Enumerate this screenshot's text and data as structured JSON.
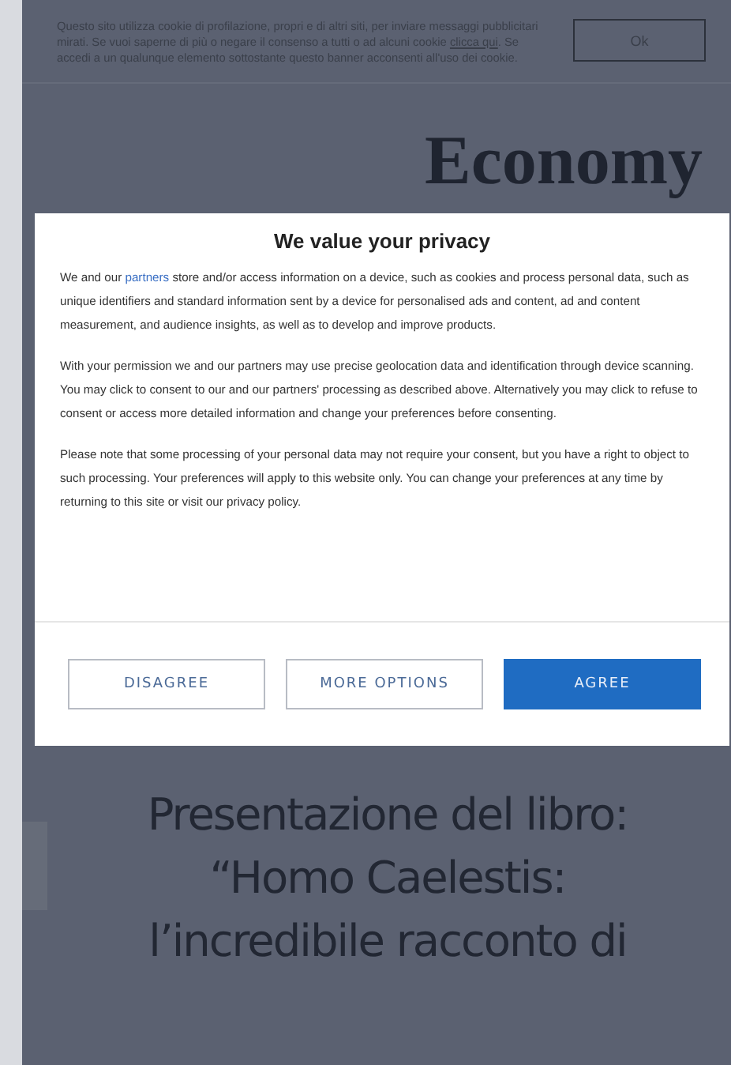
{
  "cookie_banner": {
    "text": "Questo sito utilizza cookie di profilazione, propri e di altri siti, per inviare messaggi pubblicitari mirati. Se vuoi saperne di più o negare il consenso a tutti o ad alcuni cookie **clicca qui**. Se accedi a un qualunque elemento sottostante questo banner acconsenti all'uso dei cookie.",
    "button": "Ok"
  },
  "logo": {
    "text": "Economy"
  },
  "consent_dialog": {
    "title": "We value your privacy",
    "paragraphs": [
      {
        "before": "We and our ",
        "link": "partners",
        "after": " store and/or access information on a device, such as cookies and process personal data, such as unique identifiers and standard information sent by a device for personalised ads and content, ad and content measurement, and audience insights, as well as to develop and improve products."
      },
      {
        "before": "With your permission we and our partners may use precise geolocation data and identification through device scanning. You may click to consent to our and our partners' processing as described above. Alternatively you may click to refuse to consent or access more detailed information and change your preferences before consenting."
      },
      {
        "before": "Please note that some processing of your personal data may not require your consent, but you have a right to object to such processing. Your preferences will apply to this website only. You can change your preferences at any time by returning to this site or visit our privacy policy."
      }
    ],
    "buttons": [
      {
        "label": "DISAGREE",
        "kind": "outline"
      },
      {
        "label": "MORE OPTIONS",
        "kind": "outline"
      },
      {
        "label": "AGREE",
        "kind": "primary"
      }
    ]
  },
  "article": {
    "headline_lines": [
      "Presentazione del libro:",
      "“Homo Caelestis:",
      "l’incredibile racconto di"
    ]
  }
}
